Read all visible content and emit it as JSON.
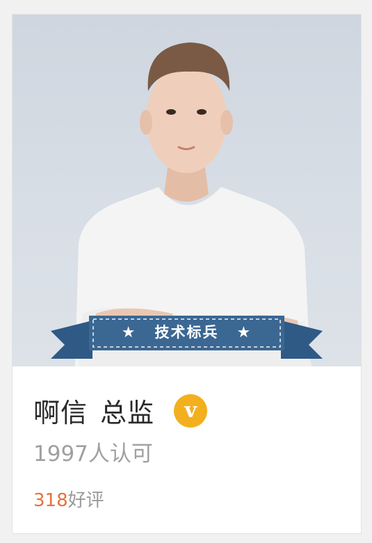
{
  "profile": {
    "banner_label": "技术标兵",
    "banner_star": "★",
    "name": "啊信",
    "title": "总监",
    "verified_mark": "v",
    "recognition_count": "1997",
    "recognition_suffix": "人认可",
    "good_reviews_count": "318",
    "good_reviews_suffix": "好评"
  },
  "colors": {
    "accent_orange": "#e8713c",
    "badge_gold": "#f2b01f",
    "banner_blue": "#3b6793"
  }
}
